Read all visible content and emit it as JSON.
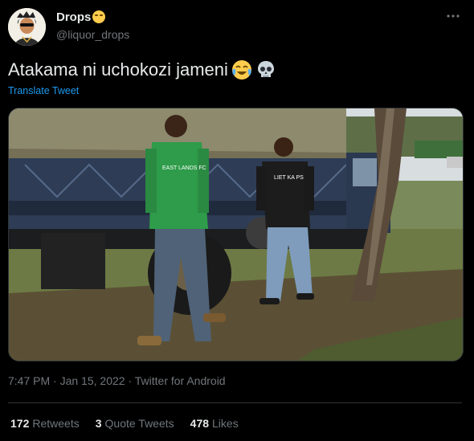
{
  "author": {
    "display_name": "Drops",
    "handle": "@liquor_drops"
  },
  "tweet": {
    "text": "Atakama ni uchokozi jameni",
    "emojis": [
      "face-with-tears-of-joy-icon",
      "skull-icon"
    ],
    "translate_label": "Translate Tweet",
    "image_text": {
      "jacket_text": "EAST LANDS FC",
      "shirt_text": "LIET KA PS"
    }
  },
  "meta": {
    "time": "7:47 PM",
    "date": "Jan 15, 2022",
    "source": "Twitter for Android"
  },
  "stats": [
    {
      "count": "172",
      "label": "Retweets"
    },
    {
      "count": "3",
      "label": "Quote Tweets"
    },
    {
      "count": "478",
      "label": "Likes"
    }
  ],
  "colors": {
    "background": "#000000",
    "text": "#e7e9ea",
    "secondary": "#71767b",
    "link": "#1d9bf0",
    "divider": "#2f3336"
  }
}
